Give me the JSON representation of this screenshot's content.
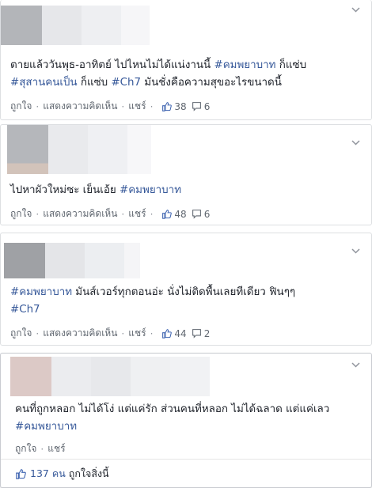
{
  "icons": {
    "chevron": "chevron-down-icon",
    "like": "thumbs-up-icon",
    "comment": "comment-bubble-icon"
  },
  "colors": {
    "hashtag": "#365899",
    "meta": "#606770",
    "border": "#dddfe2"
  },
  "posts": [
    {
      "text_before": "ตายแล้ววันพุธ-อาทิตย์ ไปไหนไม่ได้แน่งานนี้ ",
      "tag1": "#คมพยาบาท",
      "text_mid1": " ก็แซ่บ",
      "tag2": "#สุสานคนเป็น",
      "text_mid2": " ก็แซ่บ ",
      "tag3": "#Ch7",
      "text_after": " มันชั่งคือความสุขอะไรขนาดนี้",
      "like_label": "ถูกใจ",
      "comment_label": "แสดงความคิดเห็น",
      "share_label": "แชร์",
      "likes": "38",
      "comments": "6"
    },
    {
      "text_before": "ไปหาผัวใหม่ซะ เย็นเอ้ย ",
      "tag1": "#คมพยาบาท",
      "like_label": "ถูกใจ",
      "comment_label": "แสดงความคิดเห็น",
      "share_label": "แชร์",
      "likes": "48",
      "comments": "6"
    },
    {
      "tag1": "#คมพยาบาท",
      "text_mid1": " มันส์เวอร์ทุกตอนอ่ะ นั่งไม่ติดพื้นเลยทีเดียว ฟินๆๆ",
      "tag2": "#Ch7",
      "like_label": "ถูกใจ",
      "comment_label": "แสดงความคิดเห็น",
      "share_label": "แชร์",
      "likes": "44",
      "comments": "2"
    },
    {
      "text_before": "คนที่ถูกหลอก ไม่ได้โง่ แต่แค่รัก ส่วนคนที่หลอก ไม่ได้ฉลาด แต่แค่เลว",
      "tag1": "#คมพยาบาท",
      "like_label": "ถูกใจ",
      "share_label": "แชร์",
      "footer_count": "137 คน",
      "footer_text": "ถูกใจสิ่งนี้"
    }
  ]
}
